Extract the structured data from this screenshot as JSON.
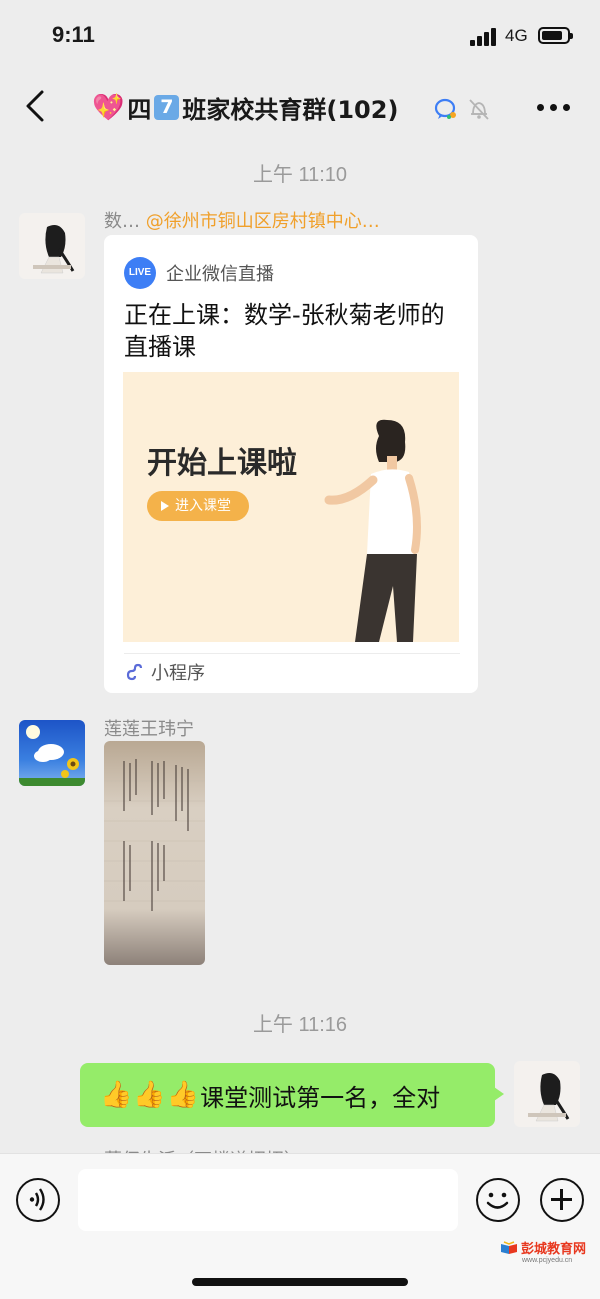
{
  "status_bar": {
    "time": "9:11",
    "network": "4G"
  },
  "nav": {
    "title_prefix": "四",
    "title_number": "7",
    "title_main": "班家校共育群(102)"
  },
  "messages": {
    "timestamp_1": "上午 11:10",
    "msg1": {
      "sender_short": "数…",
      "sender_mention": "@徐州市铜山区房村镇中心…",
      "card": {
        "app_badge": "LIVE",
        "app_name": "企业微信直播",
        "title": "正在上课：数学-张秋菊老师的直播课",
        "banner_heading": "开始上课啦",
        "banner_button": "进入课堂",
        "footer_label": "小程序"
      }
    },
    "msg2": {
      "sender": "莲莲王玮宁"
    },
    "timestamp_2": "上午 11:16",
    "msg3": {
      "text": "课堂测试第一名，全对"
    },
    "msg4": {
      "sender_partial": "蒹仔生活（石楼道招招）"
    }
  },
  "input_bar": {
    "placeholder": ""
  },
  "watermark": {
    "main": "彭城教育网",
    "sub": "www.pcjyedu.cn"
  },
  "colors": {
    "bubble_out": "#95ec69",
    "mention": "#f0a02b",
    "live_badge": "#3d7ef5",
    "banner_bg": "#fdefd8",
    "banner_button": "#f4b24a"
  }
}
